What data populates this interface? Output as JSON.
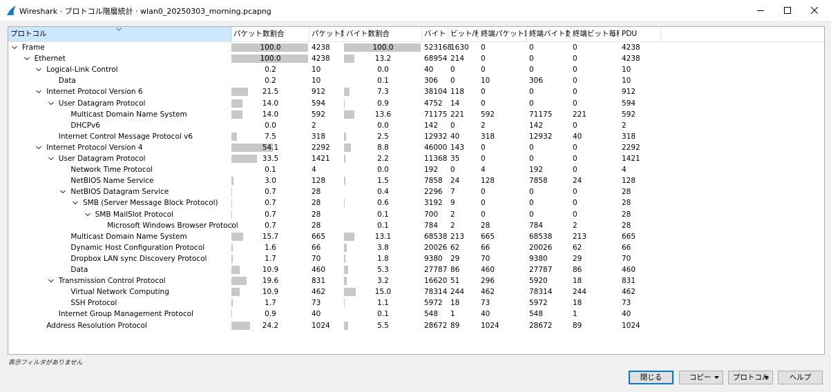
{
  "window": {
    "title": "Wireshark · プロトコル階層統計 · wlan0_20250303_morning.pcapng"
  },
  "columns": [
    "プロトコル",
    "パケット数割合",
    "パケット数",
    "バイト数割合",
    "バイト",
    "ビット/秒",
    "終端パケット数",
    "終端バイト数",
    "終端ビット毎秒",
    "PDU"
  ],
  "rows": [
    {
      "protocol": "Frame",
      "level": 0,
      "expanded": true,
      "pkt_pct": "100.0",
      "pkt_bar": 100,
      "packets": "4238",
      "byte_pct": "100.0",
      "byte_bar": 100,
      "bytes": "523168",
      "bps": "1630",
      "end_pkts": "0",
      "end_bytes": "0",
      "end_bps": "0",
      "pdu": "4238"
    },
    {
      "protocol": "Ethernet",
      "level": 1,
      "expanded": true,
      "pkt_pct": "100.0",
      "pkt_bar": 100,
      "packets": "4238",
      "byte_pct": "13.2",
      "byte_bar": 13.2,
      "bytes": "68954",
      "bps": "214",
      "end_pkts": "0",
      "end_bytes": "0",
      "end_bps": "0",
      "pdu": "4238"
    },
    {
      "protocol": "Logical-Link Control",
      "level": 2,
      "expanded": true,
      "pkt_pct": "0.2",
      "pkt_bar": 0.2,
      "packets": "10",
      "byte_pct": "0.0",
      "byte_bar": 0,
      "bytes": "40",
      "bps": "0",
      "end_pkts": "0",
      "end_bytes": "0",
      "end_bps": "0",
      "pdu": "10"
    },
    {
      "protocol": "Data",
      "level": 3,
      "expanded": null,
      "pkt_pct": "0.2",
      "pkt_bar": 0.2,
      "packets": "10",
      "byte_pct": "0.1",
      "byte_bar": 0.1,
      "bytes": "306",
      "bps": "0",
      "end_pkts": "10",
      "end_bytes": "306",
      "end_bps": "0",
      "pdu": "10"
    },
    {
      "protocol": "Internet Protocol Version 6",
      "level": 2,
      "expanded": true,
      "pkt_pct": "21.5",
      "pkt_bar": 21.5,
      "packets": "912",
      "byte_pct": "7.3",
      "byte_bar": 7.3,
      "bytes": "38104",
      "bps": "118",
      "end_pkts": "0",
      "end_bytes": "0",
      "end_bps": "0",
      "pdu": "912"
    },
    {
      "protocol": "User Datagram Protocol",
      "level": 3,
      "expanded": true,
      "pkt_pct": "14.0",
      "pkt_bar": 14.0,
      "packets": "594",
      "byte_pct": "0.9",
      "byte_bar": 0.9,
      "bytes": "4752",
      "bps": "14",
      "end_pkts": "0",
      "end_bytes": "0",
      "end_bps": "0",
      "pdu": "594"
    },
    {
      "protocol": "Multicast Domain Name System",
      "level": 4,
      "expanded": null,
      "pkt_pct": "14.0",
      "pkt_bar": 14.0,
      "packets": "592",
      "byte_pct": "13.6",
      "byte_bar": 13.6,
      "bytes": "71175",
      "bps": "221",
      "end_pkts": "592",
      "end_bytes": "71175",
      "end_bps": "221",
      "pdu": "592"
    },
    {
      "protocol": "DHCPv6",
      "level": 4,
      "expanded": null,
      "pkt_pct": "0.0",
      "pkt_bar": 0,
      "packets": "2",
      "byte_pct": "0.0",
      "byte_bar": 0,
      "bytes": "142",
      "bps": "0",
      "end_pkts": "2",
      "end_bytes": "142",
      "end_bps": "0",
      "pdu": "2"
    },
    {
      "protocol": "Internet Control Message Protocol v6",
      "level": 3,
      "expanded": null,
      "pkt_pct": "7.5",
      "pkt_bar": 7.5,
      "packets": "318",
      "byte_pct": "2.5",
      "byte_bar": 2.5,
      "bytes": "12932",
      "bps": "40",
      "end_pkts": "318",
      "end_bytes": "12932",
      "end_bps": "40",
      "pdu": "318"
    },
    {
      "protocol": "Internet Protocol Version 4",
      "level": 2,
      "expanded": true,
      "pkt_pct": "54.1",
      "pkt_bar": 54.1,
      "packets": "2292",
      "byte_pct": "8.8",
      "byte_bar": 8.8,
      "bytes": "46000",
      "bps": "143",
      "end_pkts": "0",
      "end_bytes": "0",
      "end_bps": "0",
      "pdu": "2292"
    },
    {
      "protocol": "User Datagram Protocol",
      "level": 3,
      "expanded": true,
      "pkt_pct": "33.5",
      "pkt_bar": 33.5,
      "packets": "1421",
      "byte_pct": "2.2",
      "byte_bar": 2.2,
      "bytes": "11368",
      "bps": "35",
      "end_pkts": "0",
      "end_bytes": "0",
      "end_bps": "0",
      "pdu": "1421"
    },
    {
      "protocol": "Network Time Protocol",
      "level": 4,
      "expanded": null,
      "pkt_pct": "0.1",
      "pkt_bar": 0.1,
      "packets": "4",
      "byte_pct": "0.0",
      "byte_bar": 0,
      "bytes": "192",
      "bps": "0",
      "end_pkts": "4",
      "end_bytes": "192",
      "end_bps": "0",
      "pdu": "4"
    },
    {
      "protocol": "NetBIOS Name Service",
      "level": 4,
      "expanded": null,
      "pkt_pct": "3.0",
      "pkt_bar": 3.0,
      "packets": "128",
      "byte_pct": "1.5",
      "byte_bar": 1.5,
      "bytes": "7858",
      "bps": "24",
      "end_pkts": "128",
      "end_bytes": "7858",
      "end_bps": "24",
      "pdu": "128"
    },
    {
      "protocol": "NetBIOS Datagram Service",
      "level": 4,
      "expanded": true,
      "pkt_pct": "0.7",
      "pkt_bar": 0.7,
      "packets": "28",
      "byte_pct": "0.4",
      "byte_bar": 0.4,
      "bytes": "2296",
      "bps": "7",
      "end_pkts": "0",
      "end_bytes": "0",
      "end_bps": "0",
      "pdu": "28"
    },
    {
      "protocol": "SMB (Server Message Block Protocol)",
      "level": 5,
      "expanded": true,
      "pkt_pct": "0.7",
      "pkt_bar": 0.7,
      "packets": "28",
      "byte_pct": "0.6",
      "byte_bar": 0.6,
      "bytes": "3192",
      "bps": "9",
      "end_pkts": "0",
      "end_bytes": "0",
      "end_bps": "0",
      "pdu": "28"
    },
    {
      "protocol": "SMB MailSlot Protocol",
      "level": 6,
      "expanded": true,
      "pkt_pct": "0.7",
      "pkt_bar": 0.7,
      "packets": "28",
      "byte_pct": "0.1",
      "byte_bar": 0.1,
      "bytes": "700",
      "bps": "2",
      "end_pkts": "0",
      "end_bytes": "0",
      "end_bps": "0",
      "pdu": "28"
    },
    {
      "protocol": "Microsoft Windows Browser Protocol",
      "level": 7,
      "expanded": null,
      "pkt_pct": "0.7",
      "pkt_bar": 0.7,
      "packets": "28",
      "byte_pct": "0.1",
      "byte_bar": 0.1,
      "bytes": "784",
      "bps": "2",
      "end_pkts": "28",
      "end_bytes": "784",
      "end_bps": "2",
      "pdu": "28"
    },
    {
      "protocol": "Multicast Domain Name System",
      "level": 4,
      "expanded": null,
      "pkt_pct": "15.7",
      "pkt_bar": 15.7,
      "packets": "665",
      "byte_pct": "13.1",
      "byte_bar": 13.1,
      "bytes": "68538",
      "bps": "213",
      "end_pkts": "665",
      "end_bytes": "68538",
      "end_bps": "213",
      "pdu": "665"
    },
    {
      "protocol": "Dynamic Host Configuration Protocol",
      "level": 4,
      "expanded": null,
      "pkt_pct": "1.6",
      "pkt_bar": 1.6,
      "packets": "66",
      "byte_pct": "3.8",
      "byte_bar": 3.8,
      "bytes": "20026",
      "bps": "62",
      "end_pkts": "66",
      "end_bytes": "20026",
      "end_bps": "62",
      "pdu": "66"
    },
    {
      "protocol": "Dropbox LAN sync Discovery Protocol",
      "level": 4,
      "expanded": null,
      "pkt_pct": "1.7",
      "pkt_bar": 1.7,
      "packets": "70",
      "byte_pct": "1.8",
      "byte_bar": 1.8,
      "bytes": "9380",
      "bps": "29",
      "end_pkts": "70",
      "end_bytes": "9380",
      "end_bps": "29",
      "pdu": "70"
    },
    {
      "protocol": "Data",
      "level": 4,
      "expanded": null,
      "pkt_pct": "10.9",
      "pkt_bar": 10.9,
      "packets": "460",
      "byte_pct": "5.3",
      "byte_bar": 5.3,
      "bytes": "27787",
      "bps": "86",
      "end_pkts": "460",
      "end_bytes": "27787",
      "end_bps": "86",
      "pdu": "460"
    },
    {
      "protocol": "Transmission Control Protocol",
      "level": 3,
      "expanded": true,
      "pkt_pct": "19.6",
      "pkt_bar": 19.6,
      "packets": "831",
      "byte_pct": "3.2",
      "byte_bar": 3.2,
      "bytes": "16620",
      "bps": "51",
      "end_pkts": "296",
      "end_bytes": "5920",
      "end_bps": "18",
      "pdu": "831"
    },
    {
      "protocol": "Virtual Network Computing",
      "level": 4,
      "expanded": null,
      "pkt_pct": "10.9",
      "pkt_bar": 10.9,
      "packets": "462",
      "byte_pct": "15.0",
      "byte_bar": 15.0,
      "bytes": "78314",
      "bps": "244",
      "end_pkts": "462",
      "end_bytes": "78314",
      "end_bps": "244",
      "pdu": "462"
    },
    {
      "protocol": "SSH Protocol",
      "level": 4,
      "expanded": null,
      "pkt_pct": "1.7",
      "pkt_bar": 1.7,
      "packets": "73",
      "byte_pct": "1.1",
      "byte_bar": 1.1,
      "bytes": "5972",
      "bps": "18",
      "end_pkts": "73",
      "end_bytes": "5972",
      "end_bps": "18",
      "pdu": "73"
    },
    {
      "protocol": "Internet Group Management Protocol",
      "level": 3,
      "expanded": null,
      "pkt_pct": "0.9",
      "pkt_bar": 0.9,
      "packets": "40",
      "byte_pct": "0.1",
      "byte_bar": 0.1,
      "bytes": "548",
      "bps": "1",
      "end_pkts": "40",
      "end_bytes": "548",
      "end_bps": "1",
      "pdu": "40"
    },
    {
      "protocol": "Address Resolution Protocol",
      "level": 2,
      "expanded": null,
      "pkt_pct": "24.2",
      "pkt_bar": 24.2,
      "packets": "1024",
      "byte_pct": "5.5",
      "byte_bar": 5.5,
      "bytes": "28672",
      "bps": "89",
      "end_pkts": "1024",
      "end_bytes": "28672",
      "end_bps": "89",
      "pdu": "1024"
    }
  ],
  "status": {
    "filter_text": "表示フィルタがありません"
  },
  "buttons": {
    "close": "閉じる",
    "copy": "コピー",
    "protocol": "プロトコル",
    "help": "ヘルプ"
  },
  "icons": {
    "app": "wireshark-fin-icon",
    "minimize": "minimize-icon",
    "maximize": "maximize-icon",
    "close": "close-icon",
    "expand": "chevron-down-icon",
    "dropdown": "caret-down-icon"
  },
  "colors": {
    "accent": "#0078d7",
    "selected_header": "#cce8ff",
    "bar": "#c8c8c8"
  }
}
